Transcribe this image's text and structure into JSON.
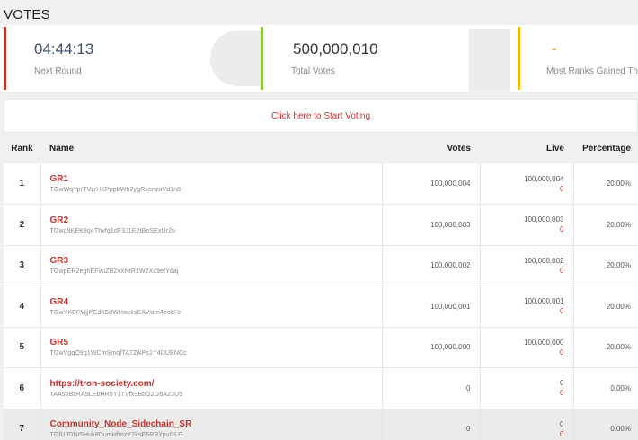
{
  "page": {
    "title": "VOTES"
  },
  "stats": [
    {
      "value": "04:44:13",
      "label": "Next Round",
      "accent": "#c0392b"
    },
    {
      "value": "500,000,010",
      "label": "Total Votes",
      "accent": "#8dc63f"
    },
    {
      "value": "-",
      "label": "Most Ranks Gained Th",
      "accent": "#f5b800"
    }
  ],
  "cta": {
    "label": "Click here to Start Voting"
  },
  "table": {
    "headers": {
      "rank": "Rank",
      "name": "Name",
      "votes": "Votes",
      "live": "Live",
      "percentage": "Percentage"
    },
    "rows": [
      {
        "rank": "1",
        "name": "GR1",
        "address": "TGwWqYprTVzrHKPppbWh2ygRxenzaVd1n8",
        "votes": "100,000,004",
        "live": "100,000,004",
        "live_change": "0",
        "percentage": "20.00%"
      },
      {
        "rank": "2",
        "name": "GR2",
        "address": "TGwg9KEK8g4Thvfg1dF3J1E2tBoSExUr2u",
        "votes": "100,000,003",
        "live": "100,000,003",
        "live_change": "0",
        "percentage": "20.00%"
      },
      {
        "rank": "3",
        "name": "GR3",
        "address": "TGwpER2eghEFvuZB2xXNtR1W2Xx9efYdaj",
        "votes": "100,000,002",
        "live": "100,000,002",
        "live_change": "0",
        "percentage": "20.00%"
      },
      {
        "rank": "4",
        "name": "GR4",
        "address": "TGwYKBFMjjPCd6BdWHau1sEAVstm4eobHr",
        "votes": "100,000,001",
        "live": "100,000,001",
        "live_change": "0",
        "percentage": "20.00%"
      },
      {
        "rank": "5",
        "name": "GR5",
        "address": "TGwVggQ9g1WCmSmqfTA7ZjkPs1Y4DUBNCc",
        "votes": "100,000,000",
        "live": "100,000,000",
        "live_change": "0",
        "percentage": "20.00%"
      },
      {
        "rank": "6",
        "name": "https://tron-society.com/",
        "address": "TAAsoBzRA9LEbHR5Y1TVfx3BbG2G8A23U9",
        "votes": "0",
        "live": "0",
        "live_change": "0",
        "percentage": "0.00%"
      },
      {
        "rank": "7",
        "name": "Community_Node_Sidechain_SR",
        "address": "TGfUJDNr5Huk8DumHfmzY2ksE6RRYpuGLG",
        "votes": "0",
        "live": "0",
        "live_change": "0",
        "percentage": "0.00%"
      }
    ]
  }
}
